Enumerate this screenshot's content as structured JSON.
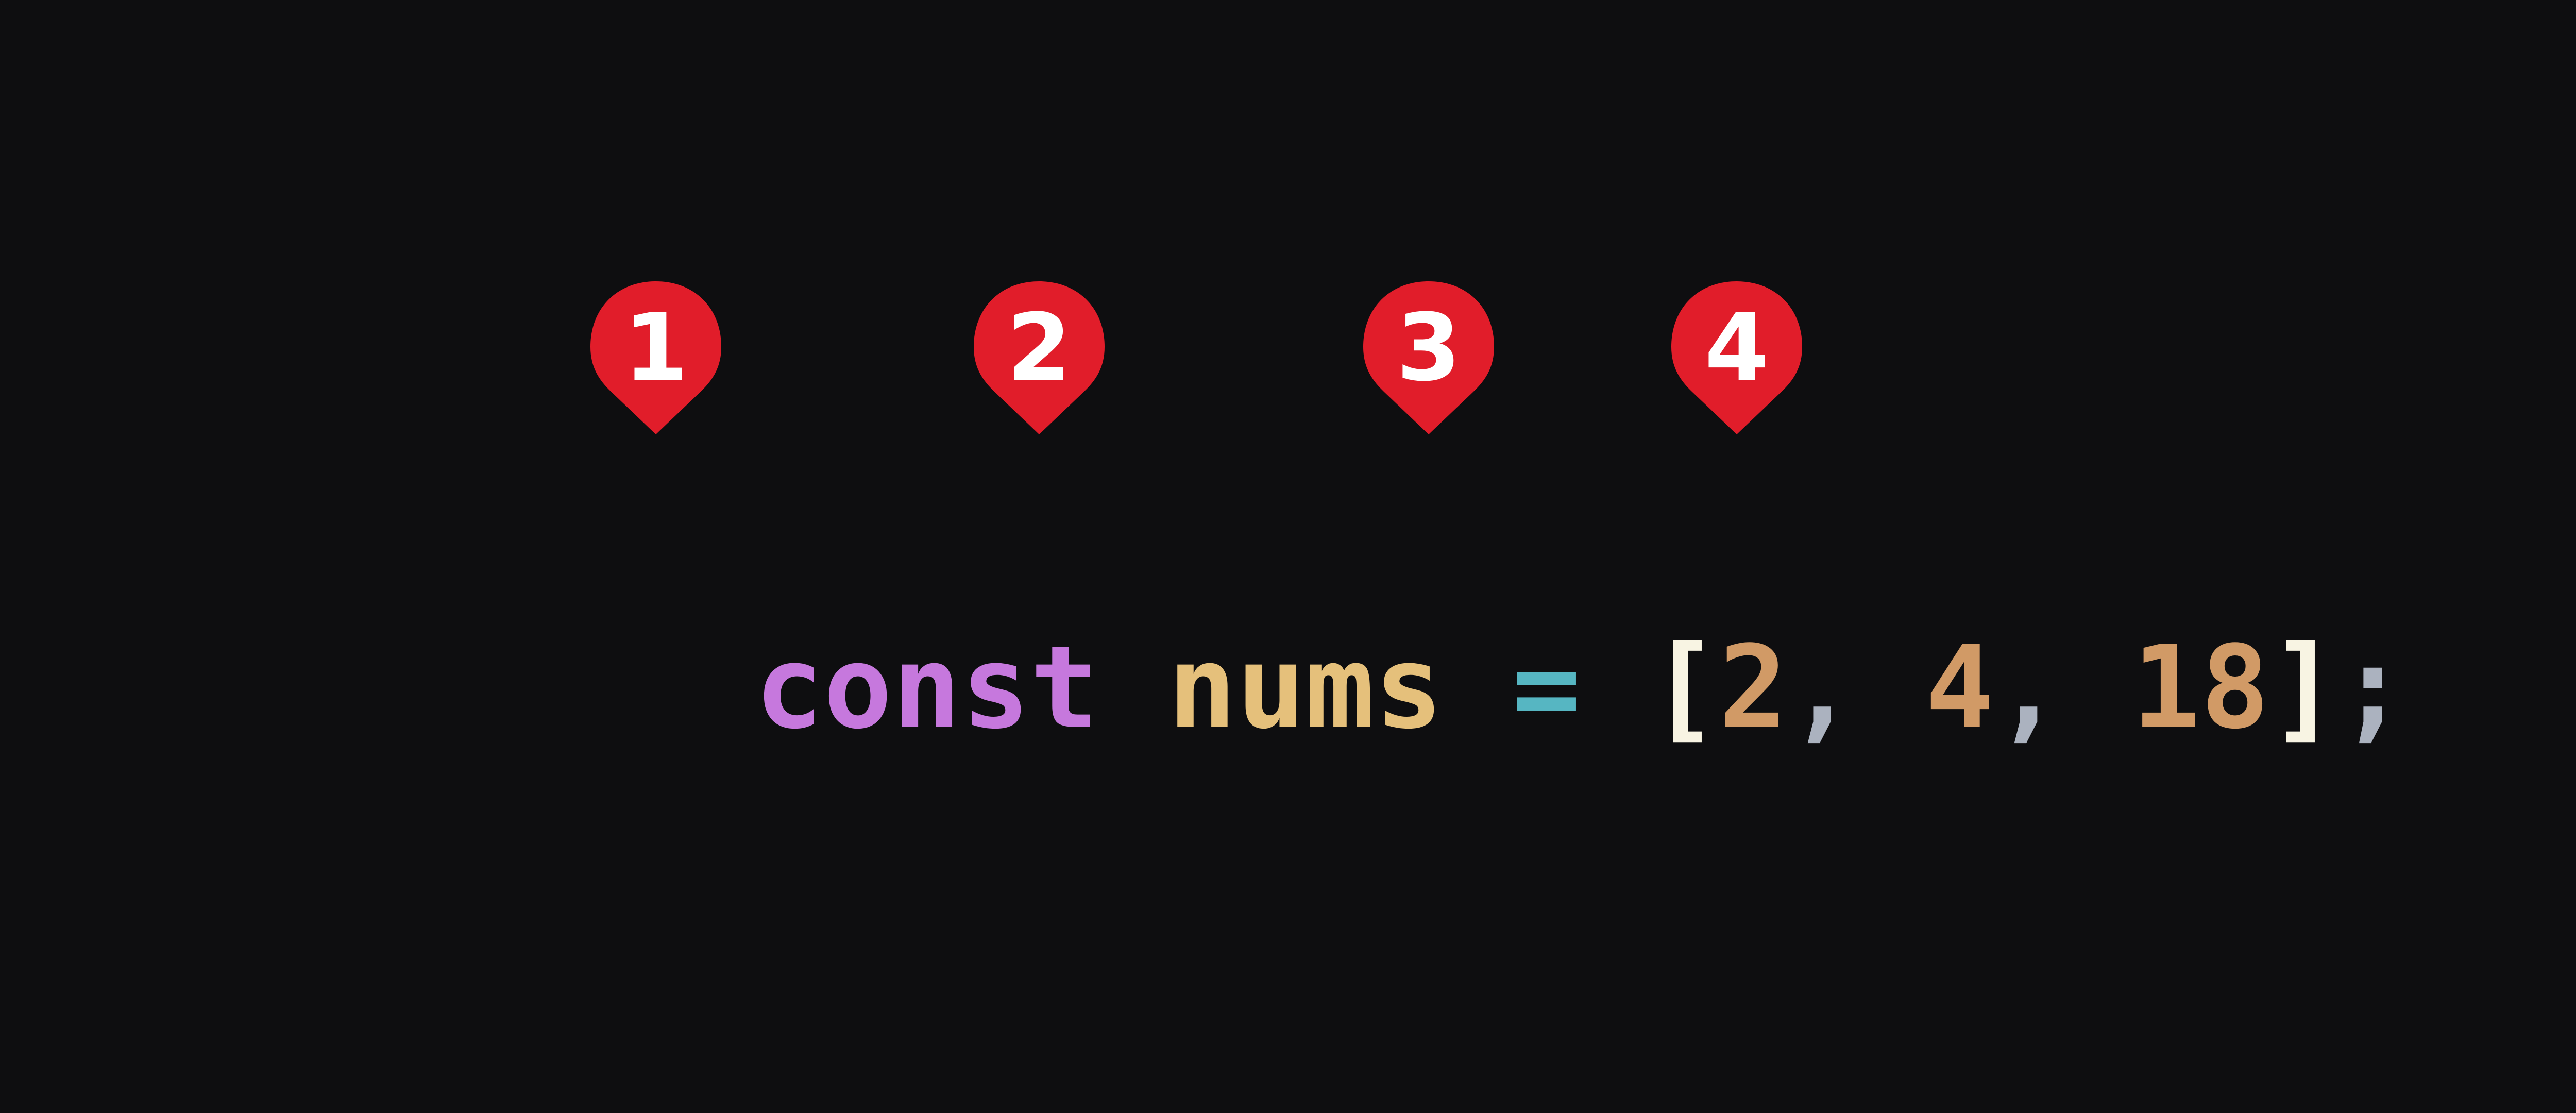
{
  "colors": {
    "background": "#0e0e10",
    "keyword": "#c678dd",
    "identifier": "#e5c07b",
    "operator": "#56b6c2",
    "bracket": "#f8f4e3",
    "number": "#d19a66",
    "punctuation": "#abb2bf",
    "marker_fill": "#e11d2a",
    "marker_text": "#ffffff"
  },
  "code": {
    "tokens": [
      {
        "text": "const",
        "role": "keyword"
      },
      {
        "text": " ",
        "role": "space"
      },
      {
        "text": "nums",
        "role": "identifier"
      },
      {
        "text": " ",
        "role": "space"
      },
      {
        "text": "=",
        "role": "operator"
      },
      {
        "text": " ",
        "role": "space"
      },
      {
        "text": "[",
        "role": "bracket"
      },
      {
        "text": "2",
        "role": "number"
      },
      {
        "text": ",",
        "role": "punctuation"
      },
      {
        "text": " ",
        "role": "space"
      },
      {
        "text": "4",
        "role": "number"
      },
      {
        "text": ",",
        "role": "punctuation"
      },
      {
        "text": " ",
        "role": "space"
      },
      {
        "text": "18",
        "role": "number"
      },
      {
        "text": "]",
        "role": "bracket"
      },
      {
        "text": ";",
        "role": "punctuation"
      }
    ]
  },
  "markers": [
    {
      "label": "1",
      "icon": "map-pin-icon"
    },
    {
      "label": "2",
      "icon": "map-pin-icon"
    },
    {
      "label": "3",
      "icon": "map-pin-icon"
    },
    {
      "label": "4",
      "icon": "map-pin-icon"
    }
  ]
}
